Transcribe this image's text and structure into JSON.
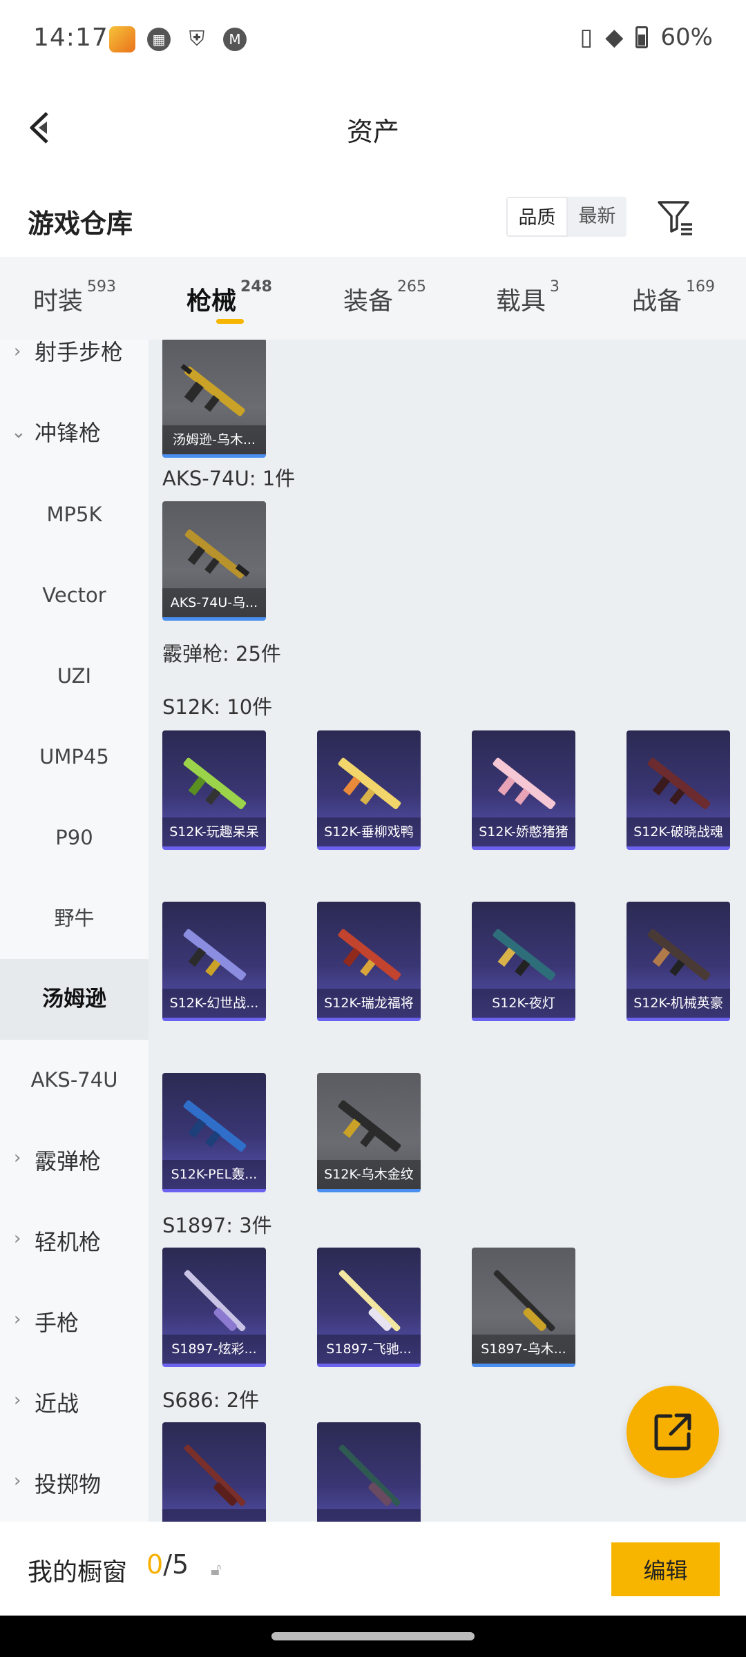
{
  "status": {
    "time": "14:17",
    "battery": "60%"
  },
  "header": {
    "title": "资产"
  },
  "warehouse": {
    "title": "游戏仓库",
    "sort_quality": "品质",
    "sort_newest": "最新"
  },
  "tabs": [
    {
      "label": "时装",
      "count": "593"
    },
    {
      "label": "枪械",
      "count": "248"
    },
    {
      "label": "装备",
      "count": "265"
    },
    {
      "label": "载具",
      "count": "3"
    },
    {
      "label": "战备",
      "count": "169"
    }
  ],
  "sidebar": {
    "categories": [
      "射手步枪",
      "冲锋枪",
      "霰弹枪",
      "轻机枪",
      "手枪",
      "近战",
      "投掷物"
    ],
    "subs": [
      "MP5K",
      "Vector",
      "UZI",
      "UMP45",
      "P90",
      "野牛",
      "汤姆逊",
      "AKS-74U"
    ]
  },
  "main": {
    "sections": [
      "AKS-74U: 1件",
      "霰弹枪: 25件",
      "S12K: 10件",
      "S1897: 3件",
      "S686: 2件"
    ],
    "items": [
      "汤姆逊-乌木...",
      "AKS-74U-乌...",
      "S12K-玩趣呆呆",
      "S12K-垂柳戏鸭",
      "S12K-娇憨猪猪",
      "S12K-破晓战魂",
      "S12K-幻世战...",
      "S12K-瑞龙福将",
      "S12K-夜灯",
      "S12K-机械英豪",
      "S12K-PEL轰...",
      "S12K-乌木金纹",
      "S1897-炫彩...",
      "S1897-飞驰...",
      "S1897-乌木...",
      "",
      ""
    ]
  },
  "bottom": {
    "label": "我的橱窗",
    "current": "0",
    "total": "/5",
    "edit": "编辑"
  },
  "colors": {
    "accent": "#f7b500",
    "rarity_purple": "#6b63f0",
    "rarity_blue": "#4a8ff0"
  }
}
